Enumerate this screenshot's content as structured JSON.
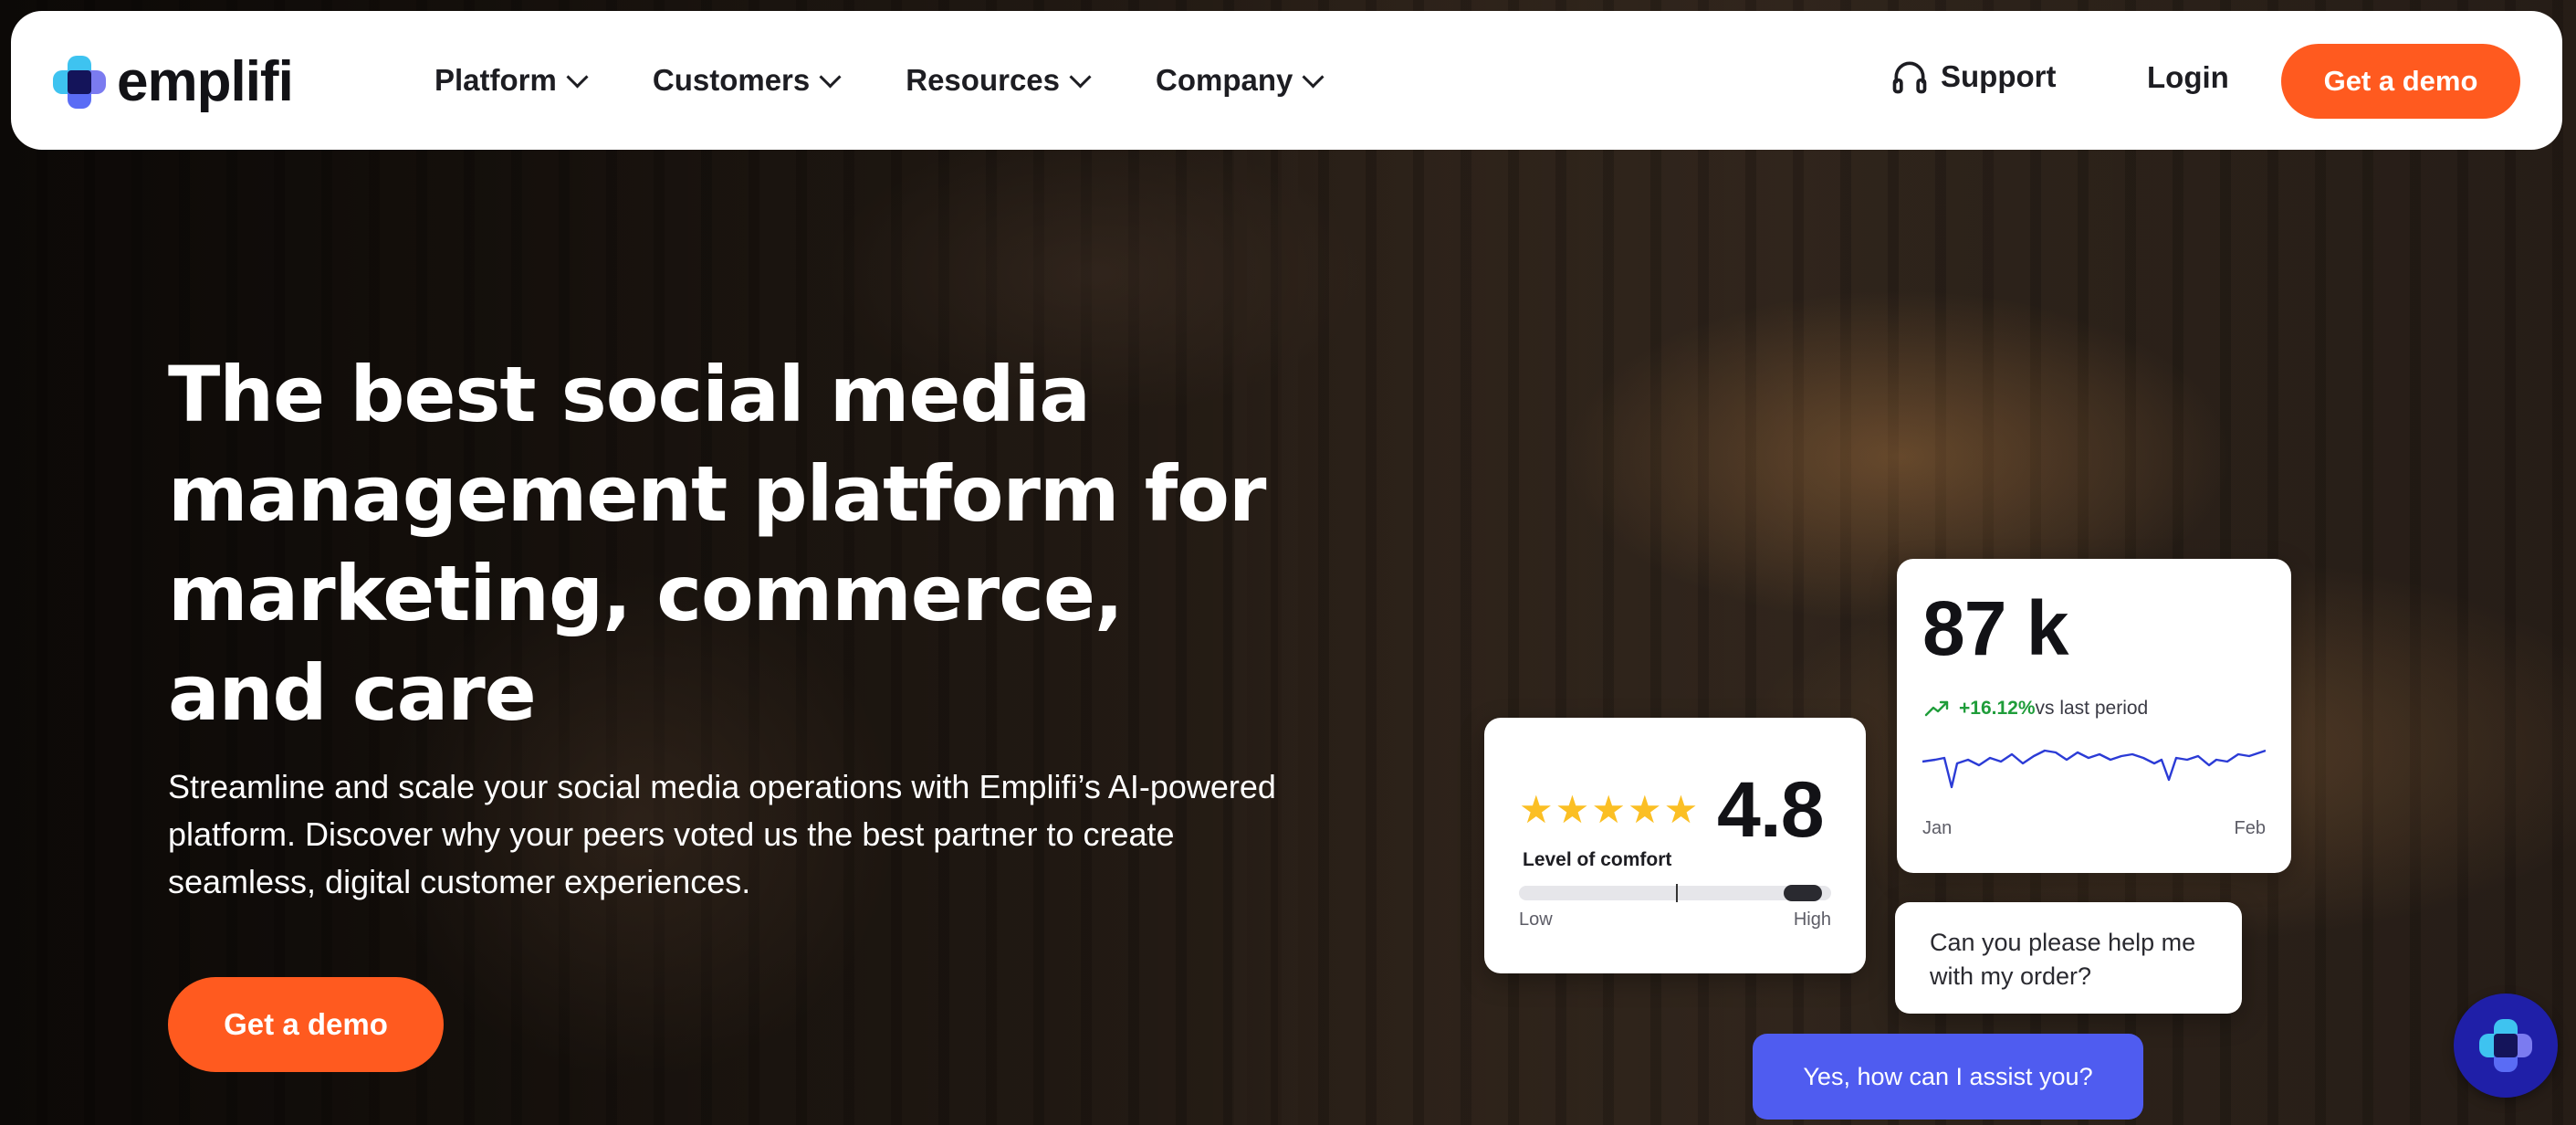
{
  "brand": {
    "name": "emplifi"
  },
  "nav": {
    "menu": [
      {
        "label": "Platform"
      },
      {
        "label": "Customers"
      },
      {
        "label": "Resources"
      },
      {
        "label": "Company"
      }
    ],
    "support_label": "Support",
    "login_label": "Login",
    "cta_label": "Get a demo"
  },
  "hero": {
    "headline": "The best social media management platform for marketing, commerce, and care",
    "subtext": "Streamline and scale your social media operations with Emplifi’s AI-powered platform. Discover why your peers voted us the best partner to create seamless, digital customer experiences.",
    "cta_label": "Get a demo"
  },
  "rating_card": {
    "stars": 5,
    "value": "4.8",
    "label": "Level of comfort",
    "low_label": "Low",
    "high_label": "High",
    "comfort_level": 0.9
  },
  "stat_card": {
    "value": "87 k",
    "change": "+16.12%",
    "change_text": "vs last period",
    "start_label": "Jan",
    "end_label": "Feb"
  },
  "chat": {
    "customer_message": "Can you please help me with my order?",
    "agent_message": "Yes, how can I assist you?"
  },
  "colors": {
    "accent": "#ff5a1f",
    "chat_blue": "#4f5cf0",
    "trend_green": "#1f9d3a",
    "star_yellow": "#fbbf24"
  },
  "icons": [
    "emplifi-logo-icon",
    "chevron-down-icon",
    "headphones-icon",
    "star-icon",
    "trend-up-icon",
    "chat-widget-icon"
  ]
}
